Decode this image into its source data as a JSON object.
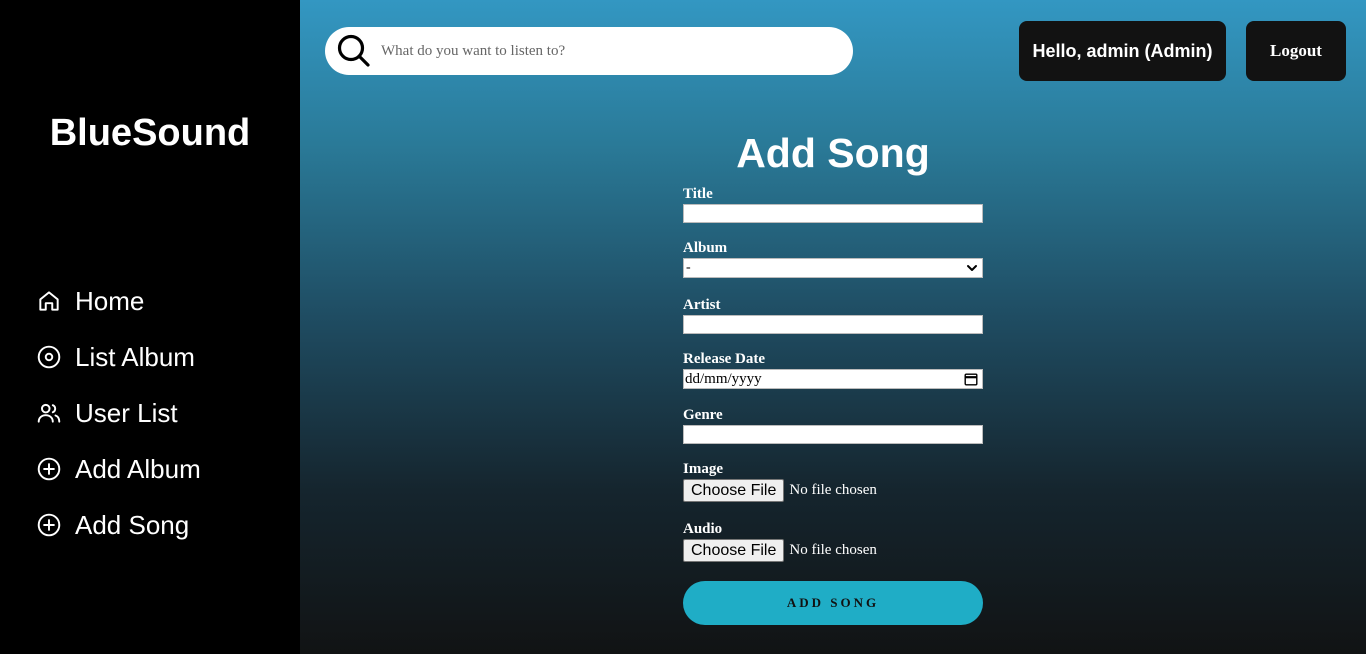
{
  "app": {
    "brand": "BlueSound"
  },
  "sidebar": {
    "items": [
      {
        "label": "Home",
        "icon": "home-icon"
      },
      {
        "label": "List Album",
        "icon": "disc-icon"
      },
      {
        "label": "User List",
        "icon": "users-icon"
      },
      {
        "label": "Add Album",
        "icon": "plus-circle-icon"
      },
      {
        "label": "Add Song",
        "icon": "plus-circle-icon"
      }
    ]
  },
  "header": {
    "search_placeholder": "What do you want to listen to?",
    "greeting": "Hello, admin (Admin)",
    "logout_label": "Logout"
  },
  "form": {
    "title": "Add Song",
    "fields": {
      "title_label": "Title",
      "album_label": "Album",
      "album_selected": "-",
      "artist_label": "Artist",
      "release_date_label": "Release Date",
      "release_date_placeholder": "dd/mm/yyyy",
      "genre_label": "Genre",
      "image_label": "Image",
      "audio_label": "Audio",
      "choose_file_label": "Choose File",
      "no_file_text": "No file chosen"
    },
    "submit_label": "ADD SONG"
  },
  "colors": {
    "accent": "#1fadc6",
    "gradient_top": "#3397c2",
    "gradient_bottom": "#111314",
    "sidebar_bg": "#000000",
    "header_button_bg": "#121212"
  }
}
